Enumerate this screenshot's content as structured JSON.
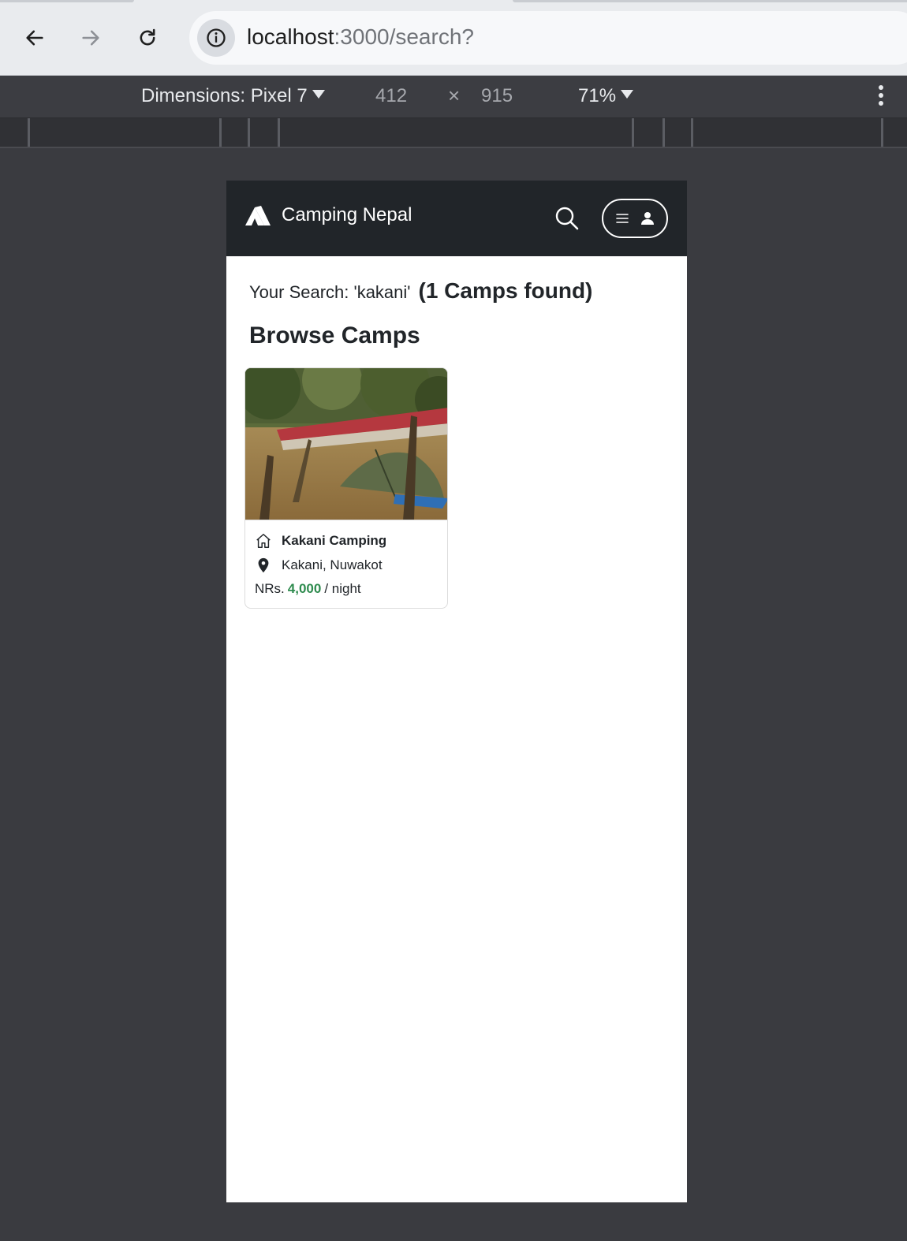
{
  "browser": {
    "url_host": "localhost",
    "url_path": ":3000/search?"
  },
  "devtools": {
    "dimensions_label": "Dimensions: Pixel 7",
    "width": "412",
    "times": "×",
    "height": "915",
    "zoom": "71%"
  },
  "navbar": {
    "brand": "Camping Nepal"
  },
  "search": {
    "query_text": "Your Search: 'kakani'",
    "count_text": "(1 Camps found)"
  },
  "section": {
    "title": "Browse Camps"
  },
  "camps": [
    {
      "name": "Kakani Camping",
      "location": "Kakani, Nuwakot",
      "price_prefix": "NRs.",
      "price": "4,000",
      "price_suffix": "/ night"
    }
  ],
  "colors": {
    "navbar_bg": "#212529",
    "price_green": "#2e8b4e",
    "devtools_bg": "#3c3d42"
  },
  "icons": [
    "back-arrow-icon",
    "forward-arrow-icon",
    "reload-icon",
    "info-icon",
    "tent-logo-icon",
    "search-icon",
    "hamburger-icon",
    "user-icon",
    "house-icon",
    "map-pin-icon",
    "more-vertical-icon"
  ]
}
